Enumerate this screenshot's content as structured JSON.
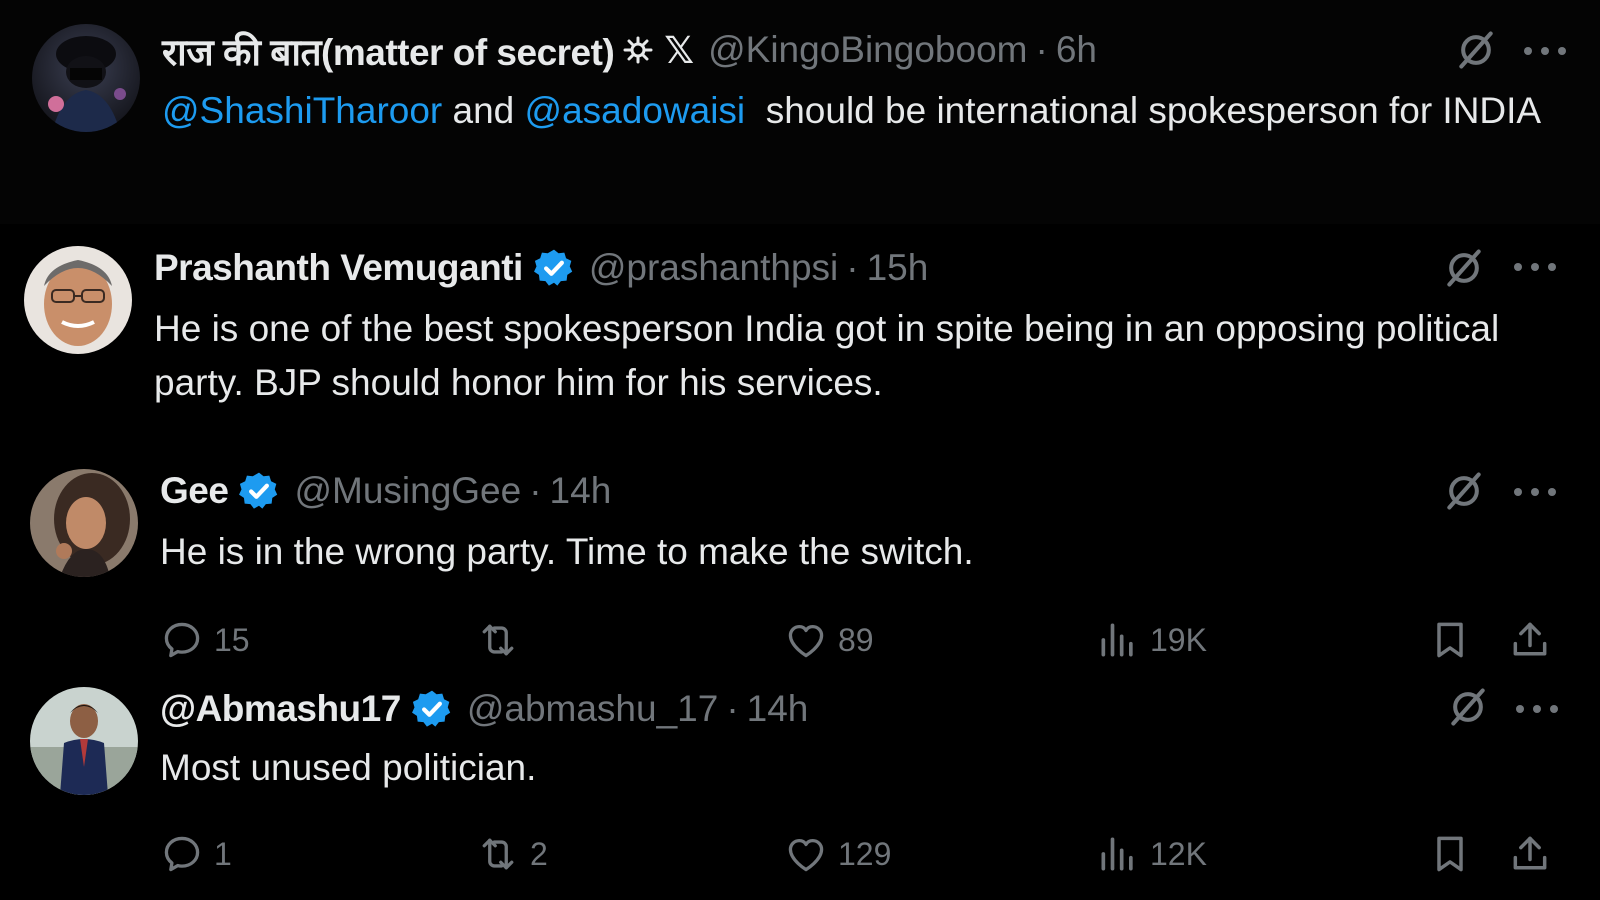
{
  "tweets": [
    {
      "name": "राज की बात(matter of secret)",
      "handle": "@KingoBingoboom",
      "time": "6h",
      "body_parts": {
        "mention1": "@ShashiTharoor",
        "text1": " and ",
        "mention2": "@asadowaisi",
        "text2": "  should be international spokesperson for INDIA"
      }
    },
    {
      "name": "Prashanth Vemuganti",
      "verified": true,
      "handle": "@prashanthpsi",
      "time": "15h",
      "body": "He is one of the best spokesperson India got in spite being in an opposing political party. BJP should honor him for his services."
    },
    {
      "name": "Gee",
      "verified": true,
      "handle": "@MusingGee",
      "time": "14h",
      "body": "He is in the wrong party. Time to make the switch.",
      "stats": {
        "replies": "15",
        "reposts": "",
        "likes": "89",
        "views": "19K"
      }
    },
    {
      "name": "@Abmashu17",
      "verified": true,
      "handle": "@abmashu_17",
      "time": "14h",
      "body": "Most unused politician.",
      "stats": {
        "replies": "1",
        "reposts": "2",
        "likes": "129",
        "views": "12K"
      }
    }
  ],
  "separator": "·",
  "x_logo": "𝕏",
  "colors": {
    "background": "#000000",
    "text": "#e7e9ea",
    "muted": "#71767b",
    "accent": "#1d9bf0"
  },
  "icons": [
    "grok-icon",
    "more-icon",
    "reply-icon",
    "repost-icon",
    "like-icon",
    "views-icon",
    "bookmark-icon",
    "share-icon",
    "verified-badge-icon"
  ]
}
